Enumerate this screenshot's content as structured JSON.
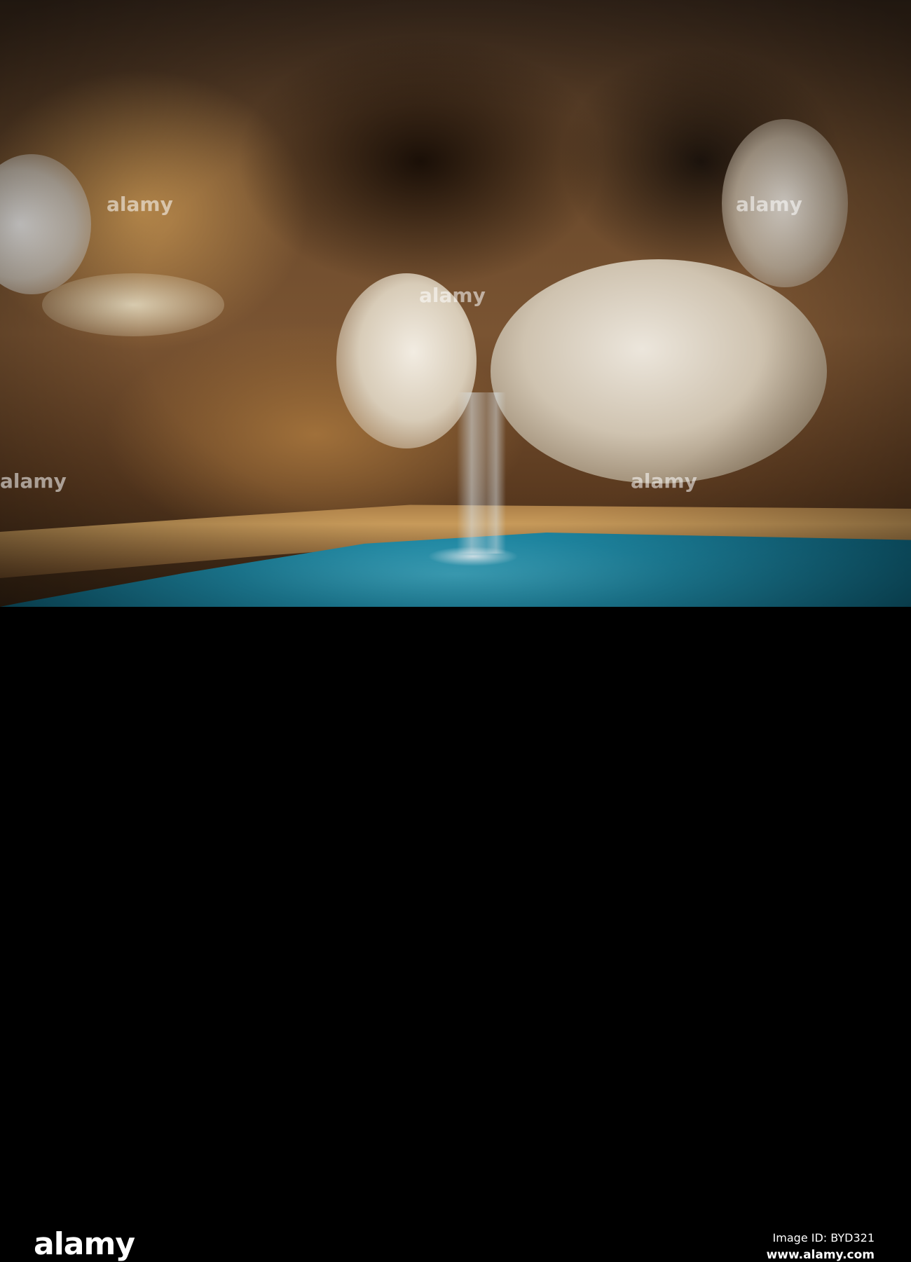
{
  "watermark": "alamy",
  "footer": {
    "logo": "alamy",
    "image_id": "Image ID: BYD321",
    "url": "www.alamy.com"
  }
}
